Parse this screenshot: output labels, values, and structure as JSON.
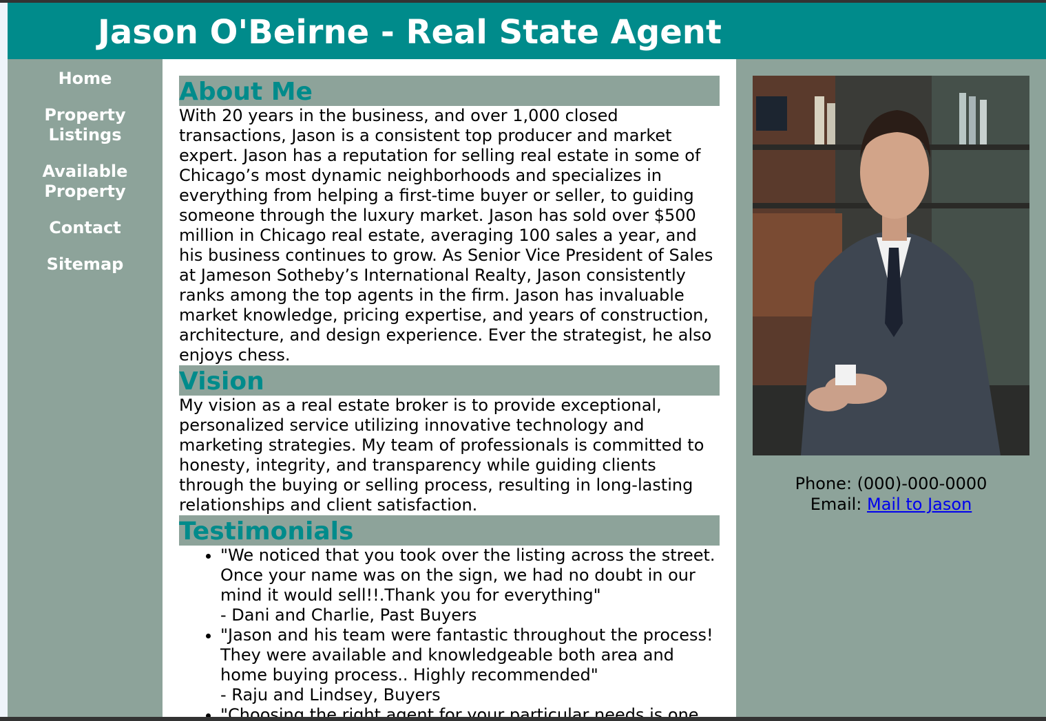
{
  "header": {
    "title": "Jason O'Beirne - Real State Agent"
  },
  "nav": {
    "items": [
      {
        "label": "Home"
      },
      {
        "label": "Property Listings"
      },
      {
        "label": "Available Property"
      },
      {
        "label": "Contact"
      },
      {
        "label": "Sitemap"
      }
    ]
  },
  "about": {
    "title": "About Me",
    "text": "With 20 years in the business, and over 1,000 closed transactions, Jason is a consistent top producer and market expert. Jason has a reputation for selling real estate in some of Chicago’s most dynamic neighborhoods and specializes in everything from helping a first-time buyer or seller, to guiding someone through the luxury market. Jason has sold over $500 million in Chicago real estate, averaging 100 sales a year, and his business continues to grow. As Senior Vice President of Sales at Jameson Sotheby’s International Realty, Jason consistently ranks among the top agents in the firm. Jason has invaluable market knowledge, pricing expertise, and years of construction, architecture, and design experience. Ever the strategist, he also enjoys chess."
  },
  "vision": {
    "title": "Vision",
    "text": "My vision as a real estate broker is to provide exceptional, personalized service utilizing innovative technology and marketing strategies. My team of professionals is committed to honesty, integrity, and transparency while guiding clients through the buying or selling process, resulting in long-lasting relationships and client satisfaction."
  },
  "testimonials": {
    "title": "Testimonials",
    "items": [
      {
        "quote": "\"We noticed that you took over the listing across the street. Once your name was on the sign, we had no doubt in our mind it would sell!!.Thank you for everything\"",
        "author": "- Dani and Charlie, Past Buyers"
      },
      {
        "quote": "\"Jason and his team were fantastic throughout the process! They were available and knowledgeable both area and home buying process.. Highly recommended\"",
        "author": "- Raju and Lindsey, Buyers"
      },
      {
        "quote": "\"Choosing the right agent for your particular needs is one",
        "author": ""
      }
    ]
  },
  "contact": {
    "phone_label": "Phone: (000)-000-0000",
    "email_prefix": "Email: ",
    "email_link": "Mail to Jason"
  },
  "colors": {
    "header": "#008b8b",
    "sidebar": "#8da39a",
    "accent_text": "#008b8b",
    "link": "#0000ee"
  }
}
